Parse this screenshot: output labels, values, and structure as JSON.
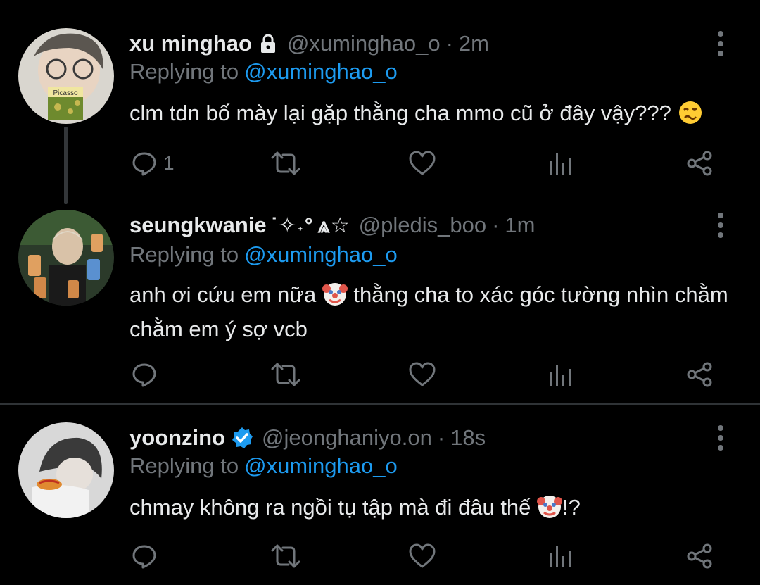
{
  "tweets": [
    {
      "name": "xu minghao",
      "badge": "lock-icon",
      "handle": "@xuminghao_o",
      "separator": "·",
      "time": "2m",
      "replying_prefix": "Replying to",
      "replying_to": "@xuminghao_o",
      "text": "clm tdn bố mày lại gặp thằng cha mmo cũ ở đây vậy??? ",
      "emoji": "woozy-face-icon",
      "reply_count": "1"
    },
    {
      "name": "seungkwanie",
      "decoration": "˙✧˖°",
      "decoration2": "⩓☆",
      "handle": "@pledis_boo",
      "separator": "·",
      "time": "1m",
      "replying_prefix": "Replying to",
      "replying_to": "@xuminghao_o",
      "text_before": "anh ơi cứu em nữa ",
      "emoji": "clown-face-icon",
      "text_after": " thằng cha to xác góc tường nhìn chằm chằm em ý sợ vcb",
      "reply_count": ""
    },
    {
      "name": "yoonzino",
      "badge": "verified-icon",
      "handle": "@jeonghaniyo.on",
      "separator": "·",
      "time": "18s",
      "replying_prefix": "Replying to",
      "replying_to": "@xuminghao_o",
      "text_before": "chmay không ra ngồi tụ tập mà đi đâu thế ",
      "emoji": "clown-face-icon",
      "text_after": "!?",
      "reply_count": ""
    }
  ],
  "colors": {
    "background": "#000000",
    "primary_text": "#e7e9ea",
    "secondary_text": "#71767b",
    "mention": "#1d9bf0",
    "verified": "#1d9bf0"
  }
}
